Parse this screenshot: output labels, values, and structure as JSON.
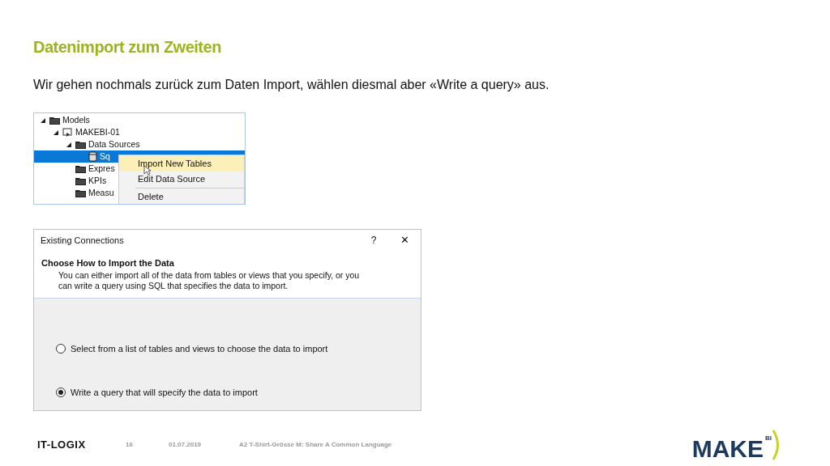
{
  "slide": {
    "title": "Datenimport zum Zweiten",
    "text": "Wir gehen nochmals zurück zum Daten Import, wählen diesmal aber «Write a query» aus."
  },
  "tree": {
    "items": [
      {
        "label": "Models",
        "kind": "folder",
        "expanded": true,
        "selected": false,
        "children": [
          {
            "label": "MAKEBI-01",
            "kind": "model",
            "expanded": true,
            "selected": false,
            "children": [
              {
                "label": "Data Sources",
                "kind": "folder",
                "expanded": true,
                "selected": false,
                "children": [
                  {
                    "label": "Sq",
                    "kind": "database",
                    "selected": true
                  }
                ]
              },
              {
                "label": "Expres",
                "kind": "folder",
                "selected": false
              },
              {
                "label": "KPIs",
                "kind": "folder",
                "selected": false
              },
              {
                "label": "Measu",
                "kind": "folder",
                "selected": false
              }
            ]
          }
        ]
      }
    ]
  },
  "context_menu": {
    "items": [
      {
        "label": "Import New Tables",
        "selected": true
      },
      {
        "label": "Edit Data Source",
        "selected": false
      },
      {
        "label": "Delete",
        "selected": false
      }
    ]
  },
  "dialog": {
    "title": "Existing Connections",
    "help": "?",
    "close": "✕",
    "heading": "Choose How to Import the Data",
    "description": "You can either import all of the data from tables or views that you specify, or you can write a query using SQL that specifies the data to import.",
    "options": [
      {
        "label": "Select from a list of tables and views to choose the data to import",
        "selected": false
      },
      {
        "label": "Write a query that will specify the data to import",
        "selected": true
      }
    ]
  },
  "footer": {
    "company": "IT-LOGIX",
    "page": "16",
    "date": "01.07.2019",
    "title": "A2 T-Shirt-Grösse M: Share A Common Language",
    "logo": "MAKE",
    "logo_sup": "BI"
  }
}
